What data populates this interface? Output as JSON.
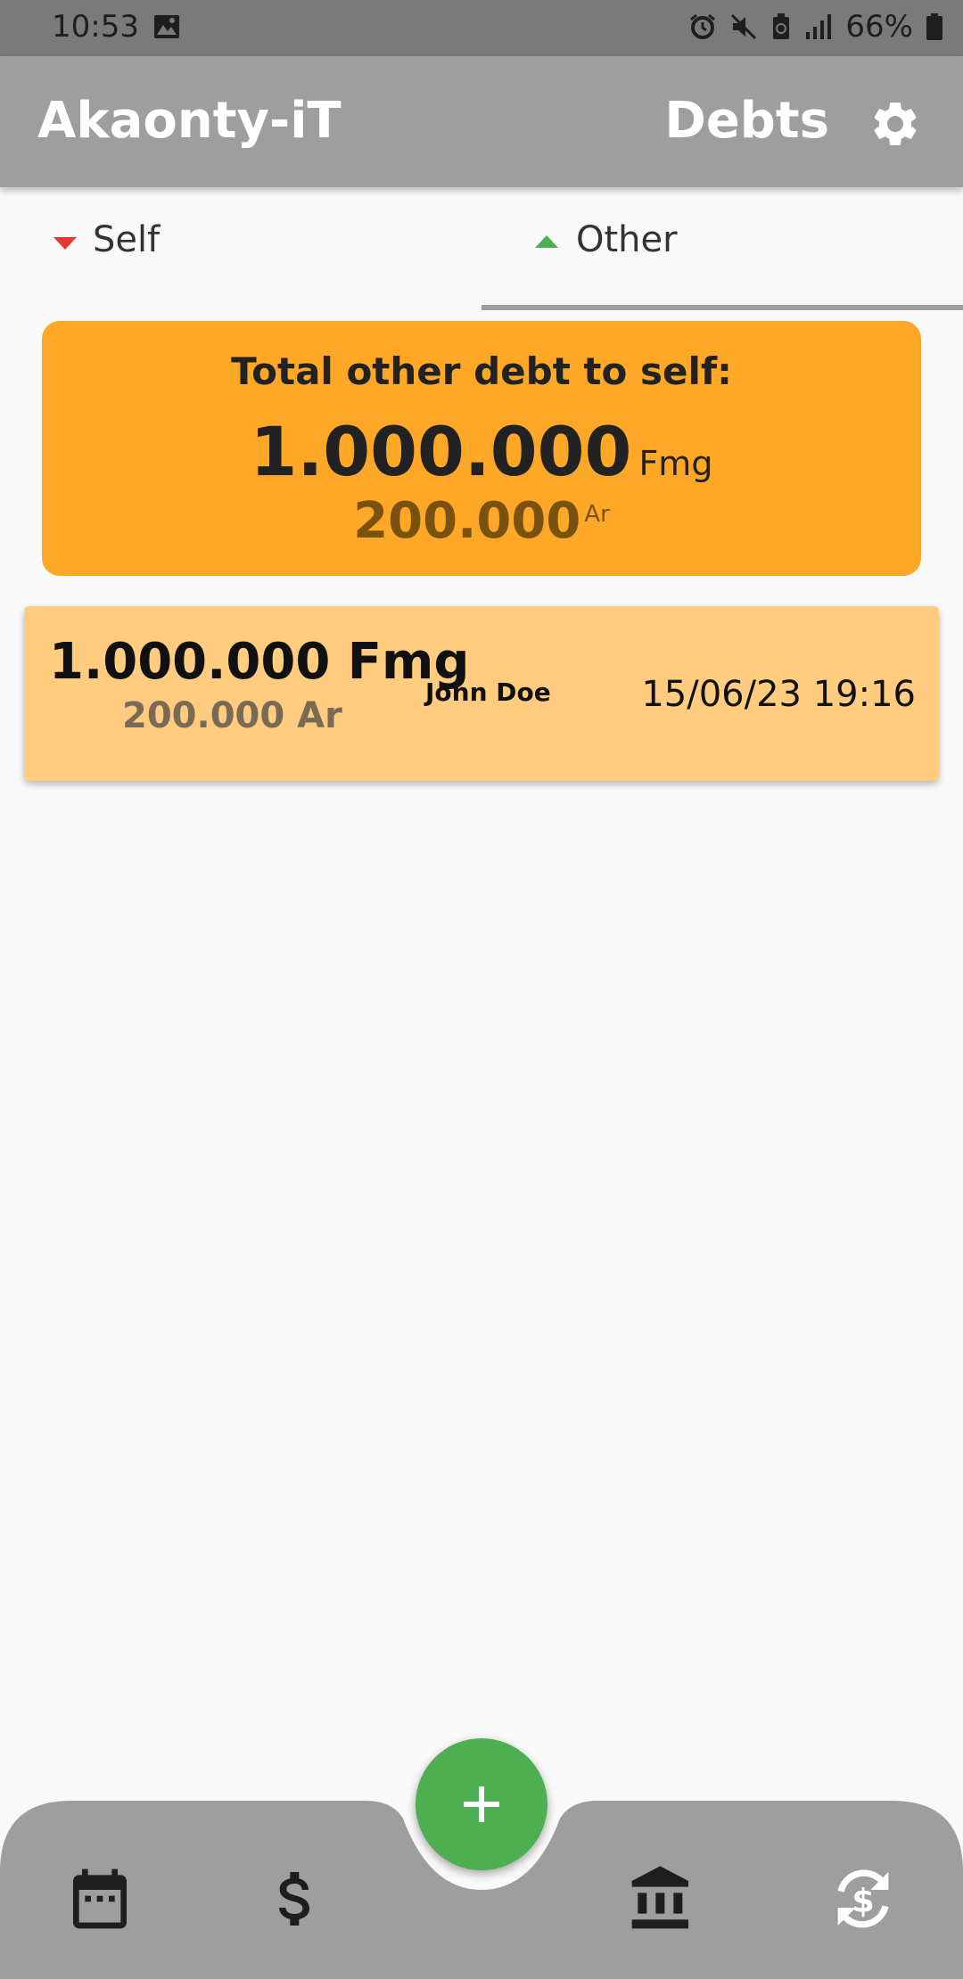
{
  "status_bar": {
    "time": "10:53",
    "battery": "66%"
  },
  "app_bar": {
    "title": "Akaonty-iT",
    "page": "Debts"
  },
  "tabs": [
    {
      "label": "Self",
      "indicator": "down-triangle",
      "color": "#e53935",
      "selected": false
    },
    {
      "label": "Other",
      "indicator": "up-triangle",
      "color": "#4caf50",
      "selected": true
    }
  ],
  "summary": {
    "heading": "Total other debt to self:",
    "amount": "1.000.000",
    "amount_unit": "Fmg",
    "converted": "200.000",
    "converted_unit": "Ar",
    "color": "#ffa726"
  },
  "debts": [
    {
      "amount": "1.000.000 Fmg",
      "converted": "200.000 Ar",
      "name": "John Doe",
      "date": "15/06/23 19:16",
      "color": "#ffcc80"
    }
  ],
  "bottom_nav": {
    "items": [
      "calendar-icon",
      "dollar-icon",
      "bank-icon",
      "currency-exchange-icon"
    ],
    "fab": "plus-icon",
    "fab_color": "#4caf50"
  }
}
